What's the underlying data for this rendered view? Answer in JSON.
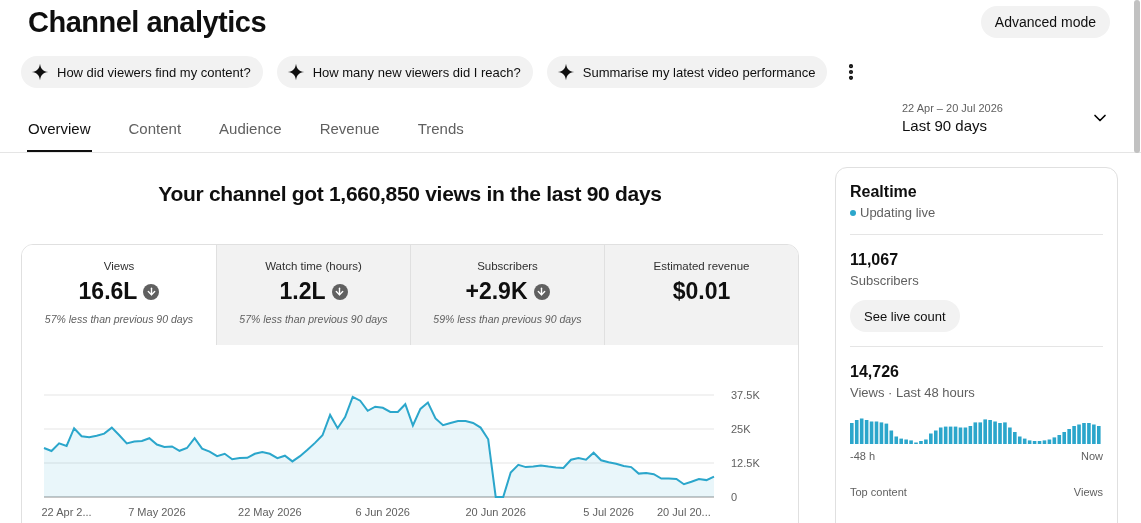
{
  "page": {
    "title": "Channel analytics",
    "advanced_button": "Advanced mode"
  },
  "suggestions": [
    "How did viewers find my content?",
    "How many new viewers did I reach?",
    "Summarise my latest video performance"
  ],
  "tabs": [
    {
      "label": "Overview",
      "selected": true
    },
    {
      "label": "Content",
      "selected": false
    },
    {
      "label": "Audience",
      "selected": false
    },
    {
      "label": "Revenue",
      "selected": false
    },
    {
      "label": "Trends",
      "selected": false
    }
  ],
  "date_range": {
    "dates": "22 Apr – 20 Jul 2026",
    "label": "Last 90 days"
  },
  "summary": {
    "headline": "Your channel got 1,660,850 views in the last 90 days"
  },
  "metrics": [
    {
      "label": "Views",
      "value": "16.6L",
      "decreased": true,
      "note": "57% less than previous 90 days",
      "selected": true
    },
    {
      "label": "Watch time (hours)",
      "value": "1.2L",
      "decreased": true,
      "note": "57% less than previous 90 days",
      "selected": false
    },
    {
      "label": "Subscribers",
      "value": "+2.9K",
      "decreased": true,
      "note": "59% less than previous 90 days",
      "selected": false
    },
    {
      "label": "Estimated revenue",
      "value": "$0.01",
      "decreased": false,
      "selected": false
    }
  ],
  "chart": {
    "chart_data": {
      "type": "area",
      "categories": [
        null,
        null,
        null,
        "22 Apr 2...",
        null,
        null,
        null,
        null,
        null,
        null,
        null,
        null,
        null,
        null,
        null,
        "7 May 2026",
        null,
        null,
        null,
        null,
        null,
        null,
        null,
        null,
        null,
        null,
        null,
        null,
        null,
        null,
        "22 May 2026",
        null,
        null,
        null,
        null,
        null,
        null,
        null,
        null,
        null,
        null,
        null,
        null,
        null,
        null,
        "6 Jun 2026",
        null,
        null,
        null,
        null,
        null,
        null,
        null,
        null,
        null,
        null,
        null,
        null,
        null,
        null,
        "20 Jun 2026",
        null,
        null,
        null,
        null,
        null,
        null,
        null,
        null,
        null,
        null,
        null,
        null,
        null,
        null,
        "5 Jul 2026",
        null,
        null,
        null,
        null,
        null,
        null,
        null,
        null,
        null,
        "20 Jul 20...",
        null,
        null,
        null,
        null
      ],
      "values": [
        18000,
        16900,
        19700,
        18800,
        25300,
        22300,
        22000,
        22500,
        23300,
        25500,
        22700,
        19700,
        20400,
        20600,
        21600,
        19300,
        18400,
        18600,
        17000,
        18000,
        21600,
        17800,
        16700,
        15000,
        15900,
        13900,
        14300,
        14400,
        15900,
        16500,
        15900,
        14300,
        15200,
        13100,
        15000,
        17400,
        19900,
        22700,
        30200,
        25300,
        29400,
        36800,
        35400,
        31700,
        33200,
        32800,
        31300,
        31300,
        34100,
        26300,
        32400,
        34700,
        28900,
        26400,
        27200,
        27900,
        27900,
        27200,
        25500,
        21200,
        0,
        0,
        9000,
        11800,
        11000,
        11200,
        11600,
        11200,
        10900,
        10700,
        13700,
        14300,
        13700,
        16300,
        13500,
        12800,
        12200,
        11400,
        11000,
        8600,
        8800,
        8400,
        6800,
        6800,
        6600,
        4700,
        5600,
        6600,
        6200,
        7500
      ],
      "ylim": [
        0,
        37500
      ],
      "yticks": [
        {
          "value": 0,
          "label": "0"
        },
        {
          "value": 12500,
          "label": "12.5K"
        },
        {
          "value": 25000,
          "label": "25K"
        },
        {
          "value": 37500,
          "label": "37.5K"
        }
      ]
    }
  },
  "realtime": {
    "title": "Realtime",
    "status": "Updating live",
    "subscribers": {
      "value": "11,067",
      "label": "Subscribers",
      "button": "See live count"
    },
    "views": {
      "value": "14,726",
      "label": "Views · Last 48 hours",
      "start": "-48 h",
      "end": "Now"
    },
    "top_content": {
      "column_1": "Top content",
      "column_2": "Views"
    }
  }
}
